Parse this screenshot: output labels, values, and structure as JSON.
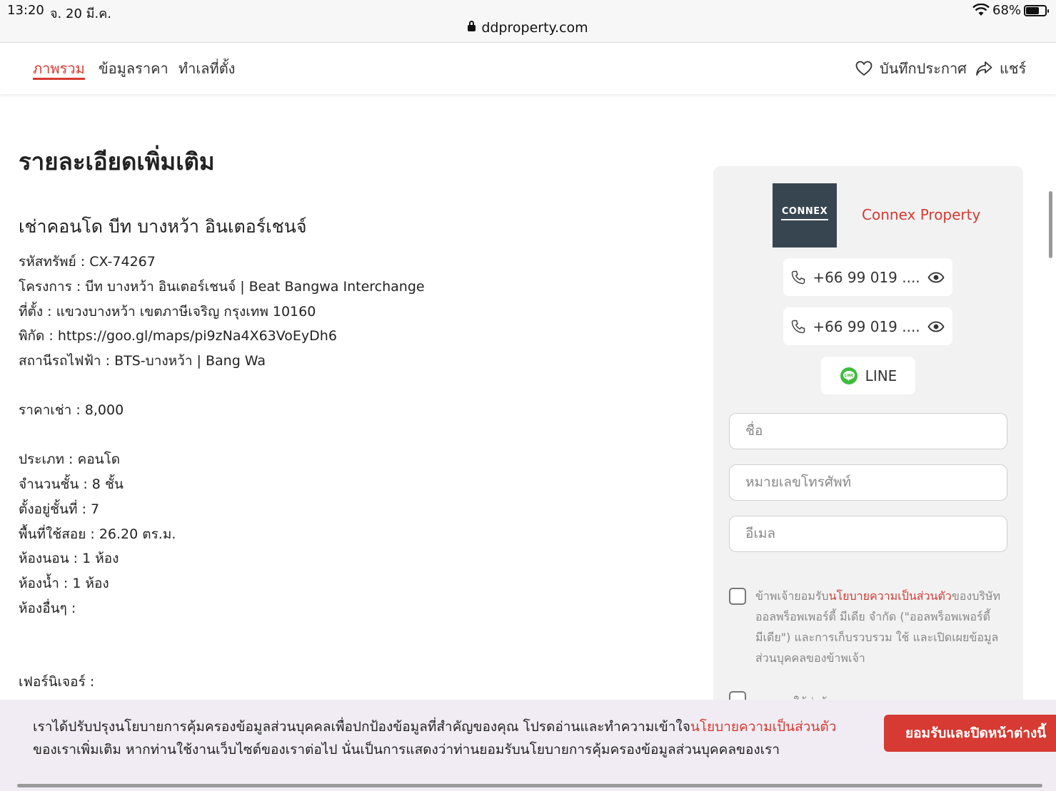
{
  "status_bar": {
    "time": "13:20",
    "date": "จ. 20 มี.ค.",
    "url": "ddproperty.com",
    "battery_pct": "68%",
    "battery_level": 0.68
  },
  "nav": {
    "tabs": [
      {
        "label": "ภาพรวม",
        "active": true
      },
      {
        "label": "ข้อมูลราคา",
        "active": false
      },
      {
        "label": "ทำเลที่ตั้ง",
        "active": false
      }
    ],
    "save_label": "บันทึกประกาศ",
    "share_label": "แชร์"
  },
  "details": {
    "heading": "รายละเอียดเพิ่มเติม",
    "listing_title": "เช่าคอนโด บีท บางหว้า อินเตอร์เชนจ์",
    "lines": [
      "รหัสทรัพย์ : CX-74267",
      "โครงการ : บีท บางหว้า อินเตอร์เชนจ์ | Beat Bangwa Interchange",
      "ที่ตั้ง : แขวงบางหว้า เขตภาษีเจริญ กรุงเทพ 10160",
      "พิกัด : https://goo.gl/maps/pi9zNa4X63VoEyDh6",
      "สถานีรถไฟฟ้า : BTS-บางหว้า | Bang Wa",
      "ราคาเช่า : 8,000",
      "ประเภท : คอนโด",
      "จำนวนชั้น : 8 ชั้น",
      "ตั้งอยู่ชั้นที่ : 7",
      "พื้นที่ใช้สอย : 26.20 ตร.ม.",
      "ห้องนอน : 1 ห้อง",
      "ห้องน้ำ : 1 ห้อง",
      "ห้องอื่นๆ :",
      "เฟอร์นิเจอร์ :"
    ]
  },
  "agent": {
    "logo_text": "CONNEX",
    "name": "Connex Property",
    "phone1": "+66 99 019 ....",
    "phone2": "+66 99 019 ....",
    "line_label": "LINE",
    "name_placeholder": "ชื่อ",
    "phone_placeholder": "หมายเลขโทรศัพท์",
    "email_placeholder": "อีเมล",
    "consent_prefix": "ข้าพเจ้ายอมรับ",
    "consent_link": "นโยบายความเป็นส่วนตัว",
    "consent_suffix": "ของบริษัท ออลพร็อพเพอร์ตี้ มีเดีย จำกัด (\"ออลพร็อพเพอร์ตี้มีเดีย\") และการเก็บรวบรวม ใช้ และเปิดเผยข้อมูลส่วนบุคคลของข้าพเจ้า",
    "consent2": "อนุญาตให้ส่งข้อมูลการตลาดแบบตรงจากออล"
  },
  "banner": {
    "text_before": "เราได้ปรับปรุงนโยบายการคุ้มครองข้อมูลส่วนบุคคลเพื่อปกป้องข้อมูลที่สำคัญของคุณ โปรดอ่านและทำความเข้าใจ",
    "link": "นโยบายความเป็นส่วนตัว",
    "text_after": "ของเราเพิ่มเติม หากท่านใช้งานเว็บไซต์ของเราต่อไป นั่นเป็นการแสดงว่าท่านยอมรับนโยบายการคุ้มครองข้อมูลส่วนบุคคลของเรา",
    "accept_label": "ยอมรับและปิดหน้าต่างนี้"
  },
  "colors": {
    "accent": "#d63a32",
    "logo_bg": "#374551",
    "card_bg": "#f2f2f2",
    "banner_bg": "#f1ecf3",
    "line_green": "#3fbd3f"
  }
}
